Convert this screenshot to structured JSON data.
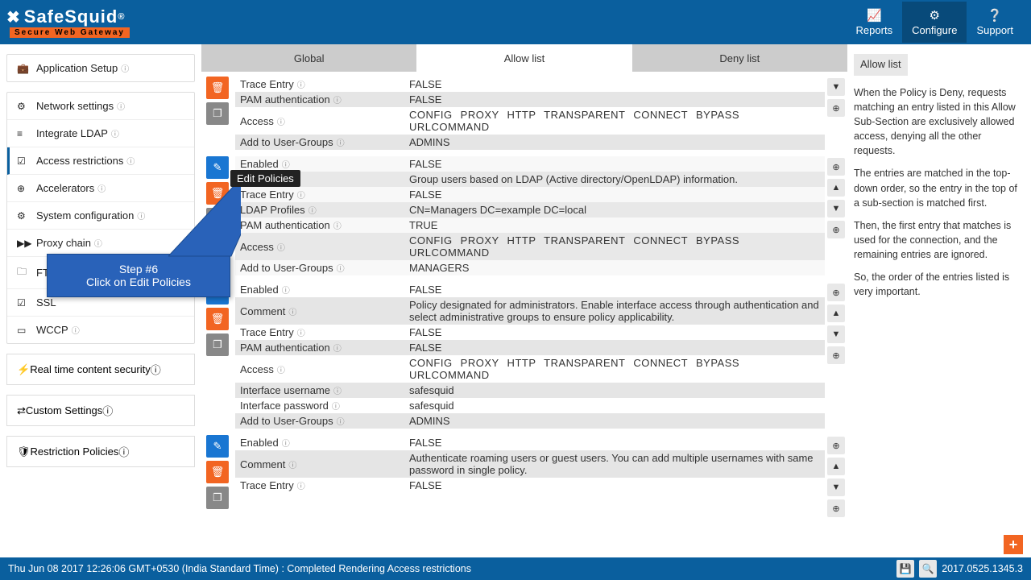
{
  "brand": {
    "name": "SafeSquid",
    "reg": "®",
    "tagline": "Secure Web Gateway"
  },
  "topnav": {
    "reports": "Reports",
    "configure": "Configure",
    "support": "Support"
  },
  "sidebar": {
    "items": [
      {
        "label": "Application Setup"
      },
      {
        "label": "Network settings"
      },
      {
        "label": "Integrate LDAP"
      },
      {
        "label": "Access restrictions"
      },
      {
        "label": "Accelerators"
      },
      {
        "label": "System configuration"
      },
      {
        "label": "Proxy chain"
      },
      {
        "label": "FTP browsing"
      },
      {
        "label": "SSL"
      },
      {
        "label": "WCCP"
      }
    ],
    "rtcs": "Real time content security",
    "custom": "Custom Settings",
    "restriction": "Restriction Policies"
  },
  "tabs": {
    "global": "Global",
    "allow": "Allow list",
    "deny": "Deny list"
  },
  "labels": {
    "enabled": "Enabled",
    "comment": "Comment",
    "trace": "Trace Entry",
    "pam": "PAM authentication",
    "ldapprof": "LDAP Profiles",
    "access": "Access",
    "addgroups": "Add to User-Groups",
    "ifuser": "Interface username",
    "ifpass": "Interface password"
  },
  "policies": [
    {
      "rows": [
        [
          "trace",
          "FALSE"
        ],
        [
          "pam",
          "FALSE"
        ],
        [
          "access",
          "CONFIG PROXY HTTP TRANSPARENT CONNECT BYPASS URLCOMMAND"
        ],
        [
          "addgroups",
          "ADMINS"
        ]
      ],
      "highlight": false,
      "cutoff_top": true
    },
    {
      "rows": [
        [
          "enabled",
          "FALSE"
        ],
        [
          "comment",
          "Group users based on LDAP (Active directory/OpenLDAP) information."
        ],
        [
          "trace",
          "FALSE"
        ],
        [
          "ldapprof",
          "CN=Managers DC=example DC=local"
        ],
        [
          "pam",
          "TRUE"
        ],
        [
          "access",
          "CONFIG PROXY HTTP TRANSPARENT CONNECT BYPASS URLCOMMAND"
        ],
        [
          "addgroups",
          "MANAGERS"
        ]
      ],
      "highlight": true
    },
    {
      "rows": [
        [
          "enabled",
          "FALSE"
        ],
        [
          "comment",
          "Policy designated for administrators. Enable interface access through authentication and select administrative groups to ensure policy applicability."
        ],
        [
          "trace",
          "FALSE"
        ],
        [
          "pam",
          "FALSE"
        ],
        [
          "access",
          "CONFIG PROXY HTTP TRANSPARENT CONNECT BYPASS URLCOMMAND"
        ],
        [
          "ifuser",
          "safesquid"
        ],
        [
          "ifpass",
          "safesquid"
        ],
        [
          "addgroups",
          "ADMINS"
        ]
      ],
      "highlight": false
    },
    {
      "rows": [
        [
          "enabled",
          "FALSE"
        ],
        [
          "comment",
          "Authenticate roaming users or guest users.\nYou can add multiple usernames with same password in single policy."
        ],
        [
          "trace",
          "FALSE"
        ]
      ],
      "highlight": false
    }
  ],
  "tooltip": {
    "edit": "Edit Policies"
  },
  "callout": {
    "title": "Step #6",
    "text": "Click on Edit Policies"
  },
  "help": {
    "title": "Allow list",
    "p1": "When the Policy is Deny, requests matching an entry listed in this Allow Sub-Section are exclusively allowed access, denying all the other requests.",
    "p2": "The entries are matched in the top-down order, so the entry in the top of a sub-section is matched first.",
    "p3": "Then, the first entry that matches is used for the connection, and the remaining entries are ignored.",
    "p4": "So, the order of the entries listed is very important."
  },
  "footer": {
    "status": "Thu Jun 08 2017 12:26:06 GMT+0530 (India Standard Time) : Completed Rendering Access restrictions",
    "build": "2017.0525.1345.3"
  }
}
